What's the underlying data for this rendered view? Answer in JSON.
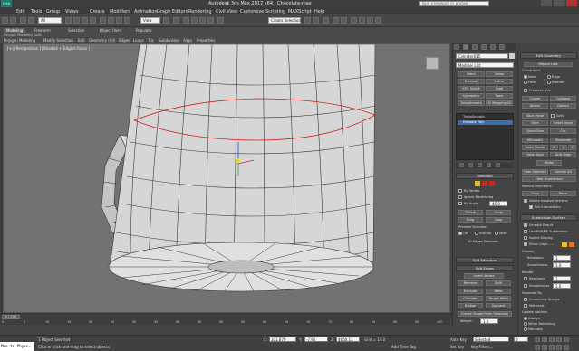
{
  "app": {
    "title": "Autodesk 3ds Max 2017 x64 - Chocolate-max",
    "search_placeholder": "Type a keyword or phrase",
    "logo_text": "MAX"
  },
  "menu": [
    "Edit",
    "Tools",
    "Group",
    "Views",
    "Create",
    "Modifiers",
    "Animation",
    "Graph Editors",
    "Rendering",
    "Civil View",
    "Customize",
    "Scripting",
    "MAXScript",
    "Help"
  ],
  "toolbar": {
    "filter_value": "All",
    "refcoord_value": "View",
    "selection_set": "Create Selection Se"
  },
  "ribbon": {
    "tabs": [
      "Modeling",
      "Freeform",
      "Selection",
      "Object Paint",
      "Populate"
    ],
    "subtabs": [
      "Polygon Modeling",
      "Modify Selection",
      "Edit",
      "Geometry (All)",
      "Edges",
      "Loops",
      "Tris",
      "Subdivision",
      "Align",
      "Properties"
    ],
    "header_label": "Polygon Modeling Tools"
  },
  "viewport": {
    "label": "[+] [Perspective ] [Shaded + Edged Faces ]"
  },
  "command_panel": {
    "object_name": "Cylinder015",
    "modifier_list": "Modifier List",
    "modifier_buttons": [
      [
        "Bend",
        "Noise"
      ],
      [
        "Extrude",
        "Lathe"
      ],
      [
        "FFD 3x3x3",
        "Shell"
      ],
      [
        "Symmetry",
        "Taper"
      ],
      [
        "TurboSmooth",
        "UV Mapping Clr"
      ]
    ],
    "stack": [
      "TurboSmooth",
      "Editable Poly"
    ],
    "selection_header": "Selection",
    "by_vertex": "By Vertex",
    "ignore_backfacing": "Ignore Backfacing",
    "by_angle": "By Angle",
    "by_angle_value": "45.0",
    "shrink": "Shrink",
    "grow": "Grow",
    "ring": "Ring",
    "loop": "Loop",
    "preview_selection": "Preview Selection",
    "preview_opts": [
      "Off",
      "SubObj",
      "Multi"
    ],
    "edges_selected": "10 Edges Selected",
    "soft_selection": "Soft Selection",
    "edit_edges": "Edit Edges",
    "insert_vertex": "Insert Vertex",
    "remove": "Remove",
    "split": "Split",
    "extrude": "Extrude",
    "weld": "Weld",
    "chamfer": "Chamfer",
    "target_weld": "Target Weld",
    "bridge": "Bridge",
    "connect": "Connect",
    "create_shape": "Create Shape From Selection",
    "weight_label": "Weight:",
    "weight_value": "1.0",
    "crease_label": "Crease:",
    "crease_value": "0.0"
  },
  "edit_geometry": {
    "header": "Edit Geometry",
    "repeat_last": "Repeat Last",
    "constraints": "Constraints",
    "constraint_opts": [
      "None",
      "Edge",
      "Face",
      "Normal"
    ],
    "preserve_uvs": "Preserve UVs",
    "create": "Create",
    "collapse": "Collapse",
    "attach": "Attach",
    "detach": "Detach",
    "slice_plane": "Slice Plane",
    "split": "Split",
    "slice": "Slice",
    "reset_plane": "Reset Plane",
    "quickslice": "QuickSlice",
    "cut": "Cut",
    "msmooth": "MSmooth",
    "tessellate": "Tessellate",
    "make_planar": "Make Planar",
    "xyz": [
      "X",
      "Y",
      "Z"
    ],
    "view_align": "View Align",
    "grid_align": "Grid Align",
    "relax": "Relax",
    "hide_selected": "Hide Selected",
    "unhide_all": "Unhide All",
    "hide_unselected": "Hide Unselected",
    "named_selections": "Named Selections:",
    "copy": "Copy",
    "paste": "Paste",
    "delete_isolated": "Delete Isolated Vertices",
    "full_interactivity": "Full Interactivity",
    "subdiv_header": "Subdivision Surface",
    "smooth_result": "Smooth Result",
    "use_nurms": "Use NURMS Subdivision",
    "isoline_display": "Isoline Display",
    "show_cage": "Show Cage......",
    "display": "Display",
    "iterations": "Iterations:",
    "iterations_value": "1",
    "smoothness": "Smoothness:",
    "smoothness_value": "1.0",
    "render": "Render",
    "separate_by": "Separate By",
    "smoothing_groups": "Smoothing Groups",
    "materials": "Materials",
    "update_options": "Update Options",
    "always": "Always",
    "when_rendering": "When Rendering",
    "manually": "Manually",
    "cage_colors": [
      "#f0c020",
      "#f07020"
    ]
  },
  "timeline": {
    "frame": "0 / 100",
    "ticks": [
      "0",
      "5",
      "10",
      "15",
      "20",
      "25",
      "30",
      "35",
      "40",
      "45",
      "50",
      "55",
      "60",
      "65",
      "70",
      "75",
      "80",
      "85",
      "90",
      "95",
      "100"
    ]
  },
  "status": {
    "script_label": "Max to Physc.",
    "objects_selected": "1 Object Selected",
    "prompt": "Click or click-and-drag to select objects",
    "x_label": "X:",
    "x_value": "101.879",
    "y_label": "Y:",
    "y_value": "-7.92",
    "z_label": "Z:",
    "z_value": "4660.11",
    "grid": "Grid = 10.0",
    "add_time_tag": "Add Time Tag",
    "autokey": "Auto Key",
    "selected": "Selected",
    "set_key": "Set Key",
    "key_filters": "Key Filters...",
    "frame_value": "0"
  },
  "colors": {
    "viewport_bg": "#727272",
    "mesh_face": "#d6d6d6",
    "mesh_edge": "#3a3a3a",
    "selected_edge": "#d02020",
    "stack_selected": "#3c6ea8"
  }
}
